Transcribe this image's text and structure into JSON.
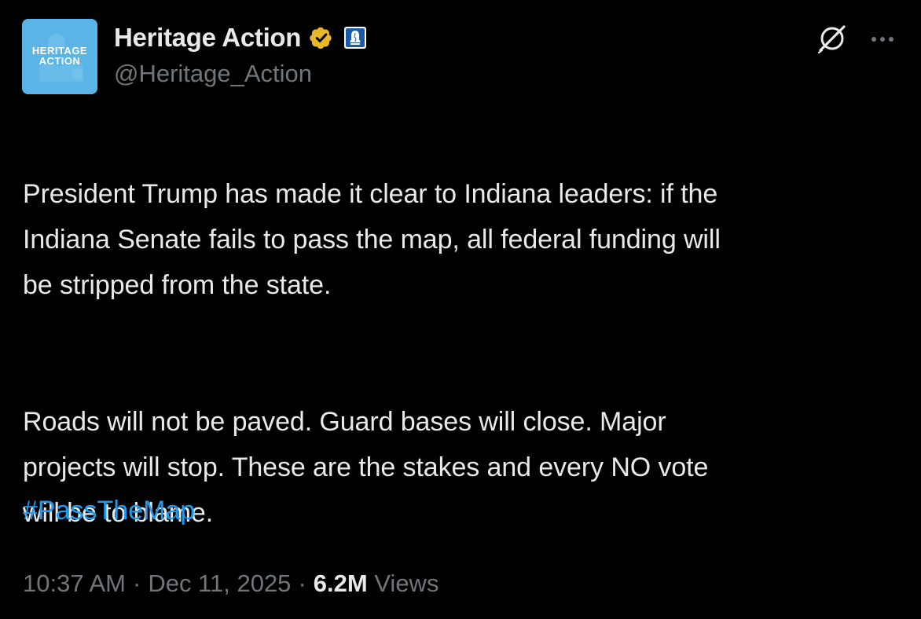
{
  "account": {
    "display_name": "Heritage Action",
    "handle": "@Heritage_Action",
    "avatar_text_line1": "HERITAGE",
    "avatar_text_line2": "ACTION",
    "avatar_bg_color": "#5ab4e6",
    "verified_badge": "gold-verified-badge-icon",
    "verified_color": "#e8b829",
    "affiliation_badge": "liberty-bell-affiliation-icon"
  },
  "actions": {
    "grok_icon": "grok-icon",
    "more_icon": "more-options-icon"
  },
  "tweet": {
    "paragraph_1": "President Trump has made it clear to Indiana leaders: if the\nIndiana Senate fails to pass the map, all federal funding will\nbe stripped from the state.",
    "paragraph_2": "Roads will not be paved. Guard bases will close. Major\nprojects will stop. These are the stakes and every NO vote\nwill be to blame.",
    "hashtag": "#PassTheMap",
    "hashtag_color": "#1d9bf0"
  },
  "meta": {
    "time": "10:37 AM",
    "separator": "·",
    "date": "Dec 11, 2025",
    "views_count": "6.2M",
    "views_label": "Views"
  },
  "colors": {
    "background": "#000000",
    "primary_text": "#e7e9ea",
    "secondary_text": "#71767b"
  }
}
